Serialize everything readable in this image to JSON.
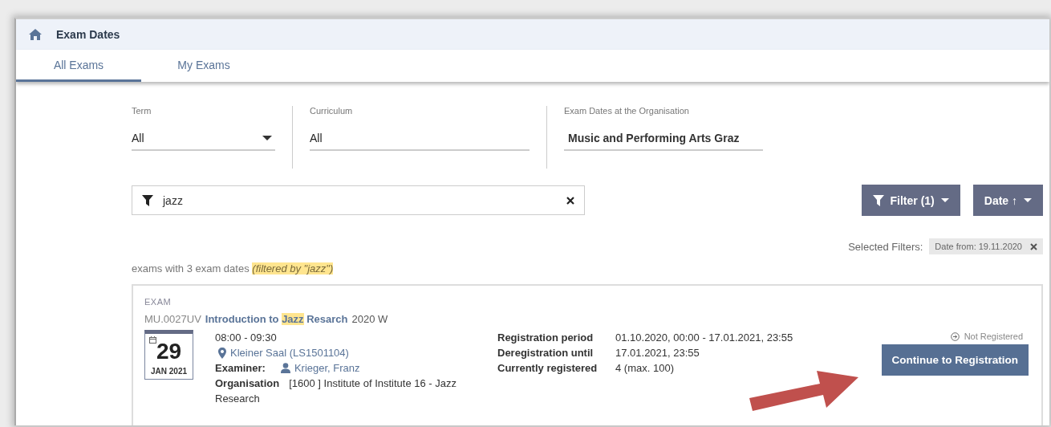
{
  "header": {
    "title": "Exam Dates"
  },
  "tabs": [
    {
      "label": "All Exams",
      "selected": true
    },
    {
      "label": "My Exams",
      "selected": false
    }
  ],
  "filters": [
    {
      "label": "Term",
      "value": "All",
      "kind": "dropdown"
    },
    {
      "label": "Curriculum",
      "value": "All",
      "kind": "text"
    },
    {
      "label": "Exam Dates at the Organisation",
      "value": "Music and Performing Arts Graz",
      "kind": "text"
    }
  ],
  "search": {
    "value": "jazz"
  },
  "buttons": {
    "filter": "Filter (1)",
    "sort": "Date ↑"
  },
  "selected_filters": {
    "label": "Selected Filters:",
    "chips": [
      {
        "text": "Date from: 19.11.2020"
      }
    ]
  },
  "summary": {
    "text": "exams with 3 exam dates",
    "note": "(filtered by \"jazz\")"
  },
  "exams": [
    {
      "type": "EXAM",
      "code": "MU.0027UV",
      "title": [
        {
          "text": "Introduction to ",
          "highlighted": false
        },
        {
          "text": "Jazz",
          "highlighted": true
        },
        {
          "text": " Resarch",
          "highlighted": false
        }
      ],
      "term": "2020 W",
      "day": "29",
      "month": "JAN 2021",
      "time": "08:00 - 09:30",
      "room": "Kleiner Saal (LS1501104)",
      "examiner_label": "Examiner:",
      "examiner": "Krieger, Franz",
      "organisation_label": "Organisation",
      "organisation": "[1600 ] Institute of Institute 16 - Jazz Research",
      "registration": [
        {
          "label": "Registration period",
          "value": "01.10.2020, 00:00 - 17.01.2021, 23:55"
        },
        {
          "label": "Deregistration until",
          "value": "17.01.2021, 23:55"
        },
        {
          "label": "Currently registered",
          "value": "4 (max. 100)"
        }
      ],
      "status": "Not Registered",
      "action": "Continue to Registration"
    }
  ]
}
